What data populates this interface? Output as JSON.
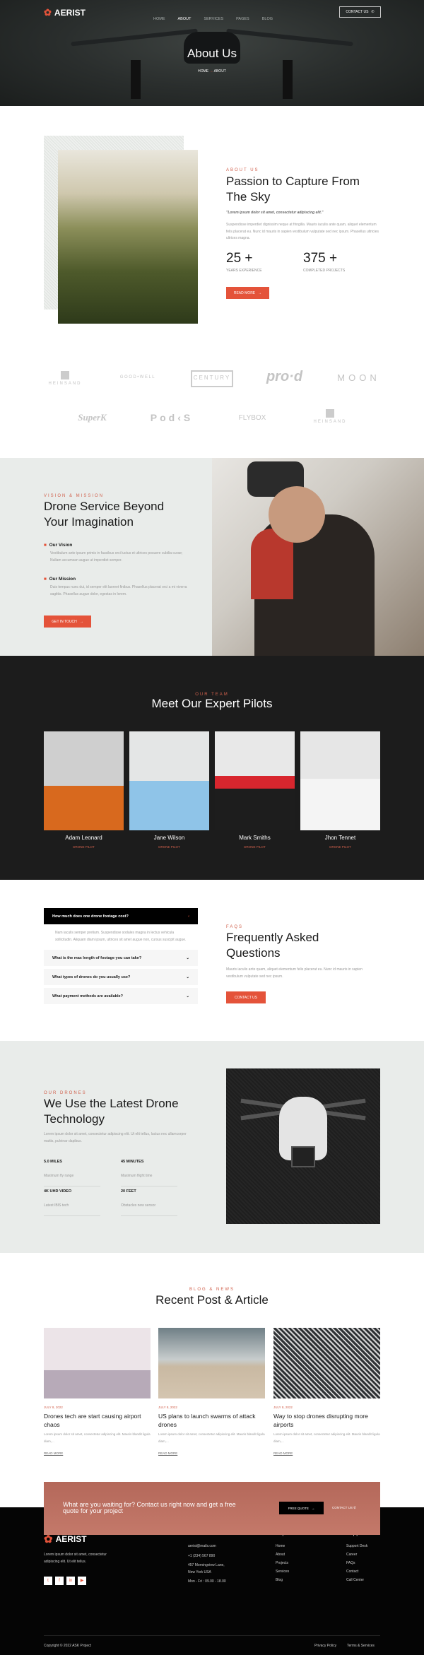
{
  "colors": {
    "accent": "#e4533a",
    "dark": "#1c1c1c",
    "light_bg": "#e9ecea"
  },
  "header": {
    "logo": "AERIST",
    "nav": [
      "HOME",
      "ABOUT",
      "SERVICES",
      "PAGES",
      "BLOG"
    ],
    "active": "ABOUT",
    "contact_label": "CONTACT US",
    "icons": {
      "logo": "drone-icon",
      "contact": "phone-icon"
    }
  },
  "hero": {
    "title": "About Us",
    "breadcrumb": [
      "HOME",
      "ABOUT"
    ]
  },
  "about": {
    "eyebrow": "ABOUT US",
    "title": "Passion to Capture From The Sky",
    "quote": "\"Lorem ipsum dolor sit amet, consectetur adipiscing elit.\"",
    "body": "Suspendisse imperdiet dignissim neque at fringilla. Mauris iaculis ante quam, aliquet elementum felis placerat eu. Nunc id mauris in sapien vestibulum vulputate sed nec ipsum. Phasellus ultricies ultrices magna.",
    "stats": [
      {
        "value": "25 +",
        "label": "YEARS EXPERIENCE"
      },
      {
        "value": "375 +",
        "label": "COMPLETED PROJECTS"
      }
    ],
    "button": "READ MORE"
  },
  "brands": [
    "HEINSAND",
    "GOOD•WELL",
    "CENTURY",
    "pro·d",
    "MOON",
    "SuperK",
    "Pod‹S",
    "FLYBOX",
    "HEINSAND"
  ],
  "vision": {
    "eyebrow": "VISION & MISSION",
    "title": "Drone Service Beyond Your Imagination",
    "items": [
      {
        "title": "Our Vision",
        "text": "Vestibulum ante ipsum primis in faucibus orci luctus et ultrices posuere cubilia curae; Nullam accumsan augue ut imperdiet semper."
      },
      {
        "title": "Our Mission",
        "text": "Duis tempus nunc dui, id semper elit laoreet finibus. Phasellus placerat orci a mi viverra sagittis. Phasellus augue dolor, egestas in lorem."
      }
    ],
    "button": "GET IN TOUCH"
  },
  "team": {
    "eyebrow": "OUR TEAM",
    "title": "Meet Our Expert Pilots",
    "members": [
      {
        "name": "Adam Leonard",
        "role": "DRONE PILOT"
      },
      {
        "name": "Jane Wilson",
        "role": "DRONE PILOT"
      },
      {
        "name": "Mark Smiths",
        "role": "DRONE PILOT"
      },
      {
        "name": "Jhon Tennet",
        "role": "DRONE PILOT"
      }
    ]
  },
  "faq": {
    "eyebrow": "FAQS",
    "title": "Frequently Asked Questions",
    "body": "Mauris iaculis ante quam, aliquet elementum felis placerat eu. Nunc id mauris in sapien vestibulum vulputate sed nec ipsum.",
    "button": "CONTACT US",
    "open": {
      "q": "How much does one drone footage cost?",
      "a": "Nam iaculis semper pretium. Suspendisse sodales magna in lectus vehicula sollicitudin. Aliquam diam ipsum, ultrices sit amet augue non, cursus suscipit augue."
    },
    "items": [
      "What is the max length of footage you can take?",
      "What types of drones do you usually use?",
      "What payment methods are available?"
    ]
  },
  "drones": {
    "eyebrow": "OUR DRONES",
    "title": "We Use the Latest Drone Technology",
    "body": "Lorem ipsum dolor sit amet, consectetur adipiscing elit. Ut elit tellus, luctus nec ullamcorper mattis, pulvinar dapibus.",
    "specs": [
      {
        "value": "5.0 MILES",
        "label": "Maximum fly range"
      },
      {
        "value": "45 MINUTES",
        "label": "Maximum flight time"
      },
      {
        "value": "4K UHD VIDEO",
        "label": "Latest IBIS tech"
      },
      {
        "value": "20 FEET",
        "label": "Obstacles new sensor"
      }
    ]
  },
  "blog": {
    "eyebrow": "BLOG & NEWS",
    "title": "Recent Post & Article",
    "posts": [
      {
        "date": "JULY 8, 2022",
        "title": "Drones tech are start causing airport chaos",
        "excerpt": "Lorem ipsum dolor sit amet, consectetur adipiscing elit. Mauris blandit ligula diam,...",
        "more": "READ MORE"
      },
      {
        "date": "JULY 8, 2022",
        "title": "US plans to launch swarms of attack drones",
        "excerpt": "Lorem ipsum dolor sit amet, consectetur adipiscing elit. Mauris blandit ligula diam,...",
        "more": "READ MORE"
      },
      {
        "date": "JULY 8, 2022",
        "title": "Way to stop drones disrupting more airports",
        "excerpt": "Lorem ipsum dolor sit amet, consectetur adipiscing elit. Mauris blandit ligula diam,...",
        "more": "READ MORE"
      }
    ]
  },
  "cta": {
    "text": "What are you waiting for? Contact us right now and get a free quote for your project",
    "quote_button": "FREE QUOTE",
    "contact_button": "CONTACT US"
  },
  "footer": {
    "logo": "AERIST",
    "about": "Lorem ipsum dolor sit amet, consectetur adipiscing elit. Ut elit tellus.",
    "social": [
      "twitter-icon",
      "facebook-icon",
      "linkedin-icon",
      "youtube-icon"
    ],
    "contact": {
      "title": "Contact",
      "email": "aerist@mails.com",
      "phone": "+1 (234) 567 890",
      "address1": "457 Morningview Lane,",
      "address2": "New York USA",
      "hours": "Mon - Fri : 09.00 - 18.00"
    },
    "explore": {
      "title": "Explore",
      "links": [
        "Home",
        "About",
        "Projects",
        "Services",
        "Blog"
      ]
    },
    "support": {
      "title": "Support",
      "links": [
        "Support Desk",
        "Career",
        "FAQs",
        "Contact",
        "Call Center"
      ]
    },
    "copyright": "Copyright © 2022 ASK Project",
    "legal": [
      "Privacy Policy",
      "Terms & Services"
    ]
  }
}
